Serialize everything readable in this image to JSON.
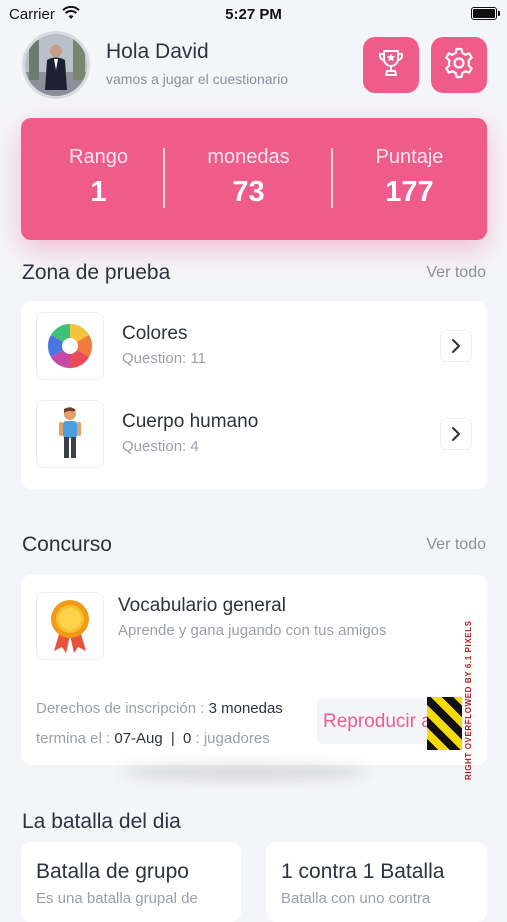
{
  "status_bar": {
    "carrier": "Carrier",
    "time": "5:27 PM"
  },
  "header": {
    "greeting": "Hola David",
    "subtitle": "vamos a jugar el cuestionario"
  },
  "stats": [
    {
      "label": "Rango",
      "value": "1"
    },
    {
      "label": "monedas",
      "value": "73"
    },
    {
      "label": "Puntaje",
      "value": "177"
    }
  ],
  "test_zone": {
    "title": "Zona de prueba",
    "see_all": "Ver todo",
    "items": [
      {
        "title": "Colores",
        "subtitle": "Question: 11",
        "icon": "color-wheel-icon"
      },
      {
        "title": "Cuerpo humano",
        "subtitle": "Question: 4",
        "icon": "human-figure-icon"
      }
    ]
  },
  "contest": {
    "title": "Concurso",
    "see_all": "Ver todo",
    "item_title": "Vocabulario general",
    "item_subtitle": "Aprende y gana jugando con tus amigos",
    "fee_label": "Derechos de inscripción :",
    "fee_value": "3 monedas",
    "ends_label": "termina el :",
    "ends_value": "07-Aug",
    "separator": "|",
    "players_value": "0",
    "players_label": ": jugadores",
    "play_label": "Reproducir a",
    "overflow_text": "RIGHT OVERFLOWED BY 6.1 PIXELS"
  },
  "battle": {
    "title": "La batalla del dia",
    "cards": [
      {
        "title": "Batalla de grupo",
        "subtitle": "Es una batalla grupal de"
      },
      {
        "title": "1 contra 1 Batalla",
        "subtitle": "Batalla con uno contra"
      }
    ]
  },
  "colors": {
    "accent": "#ef5b8a",
    "background": "#f4f5f8"
  }
}
